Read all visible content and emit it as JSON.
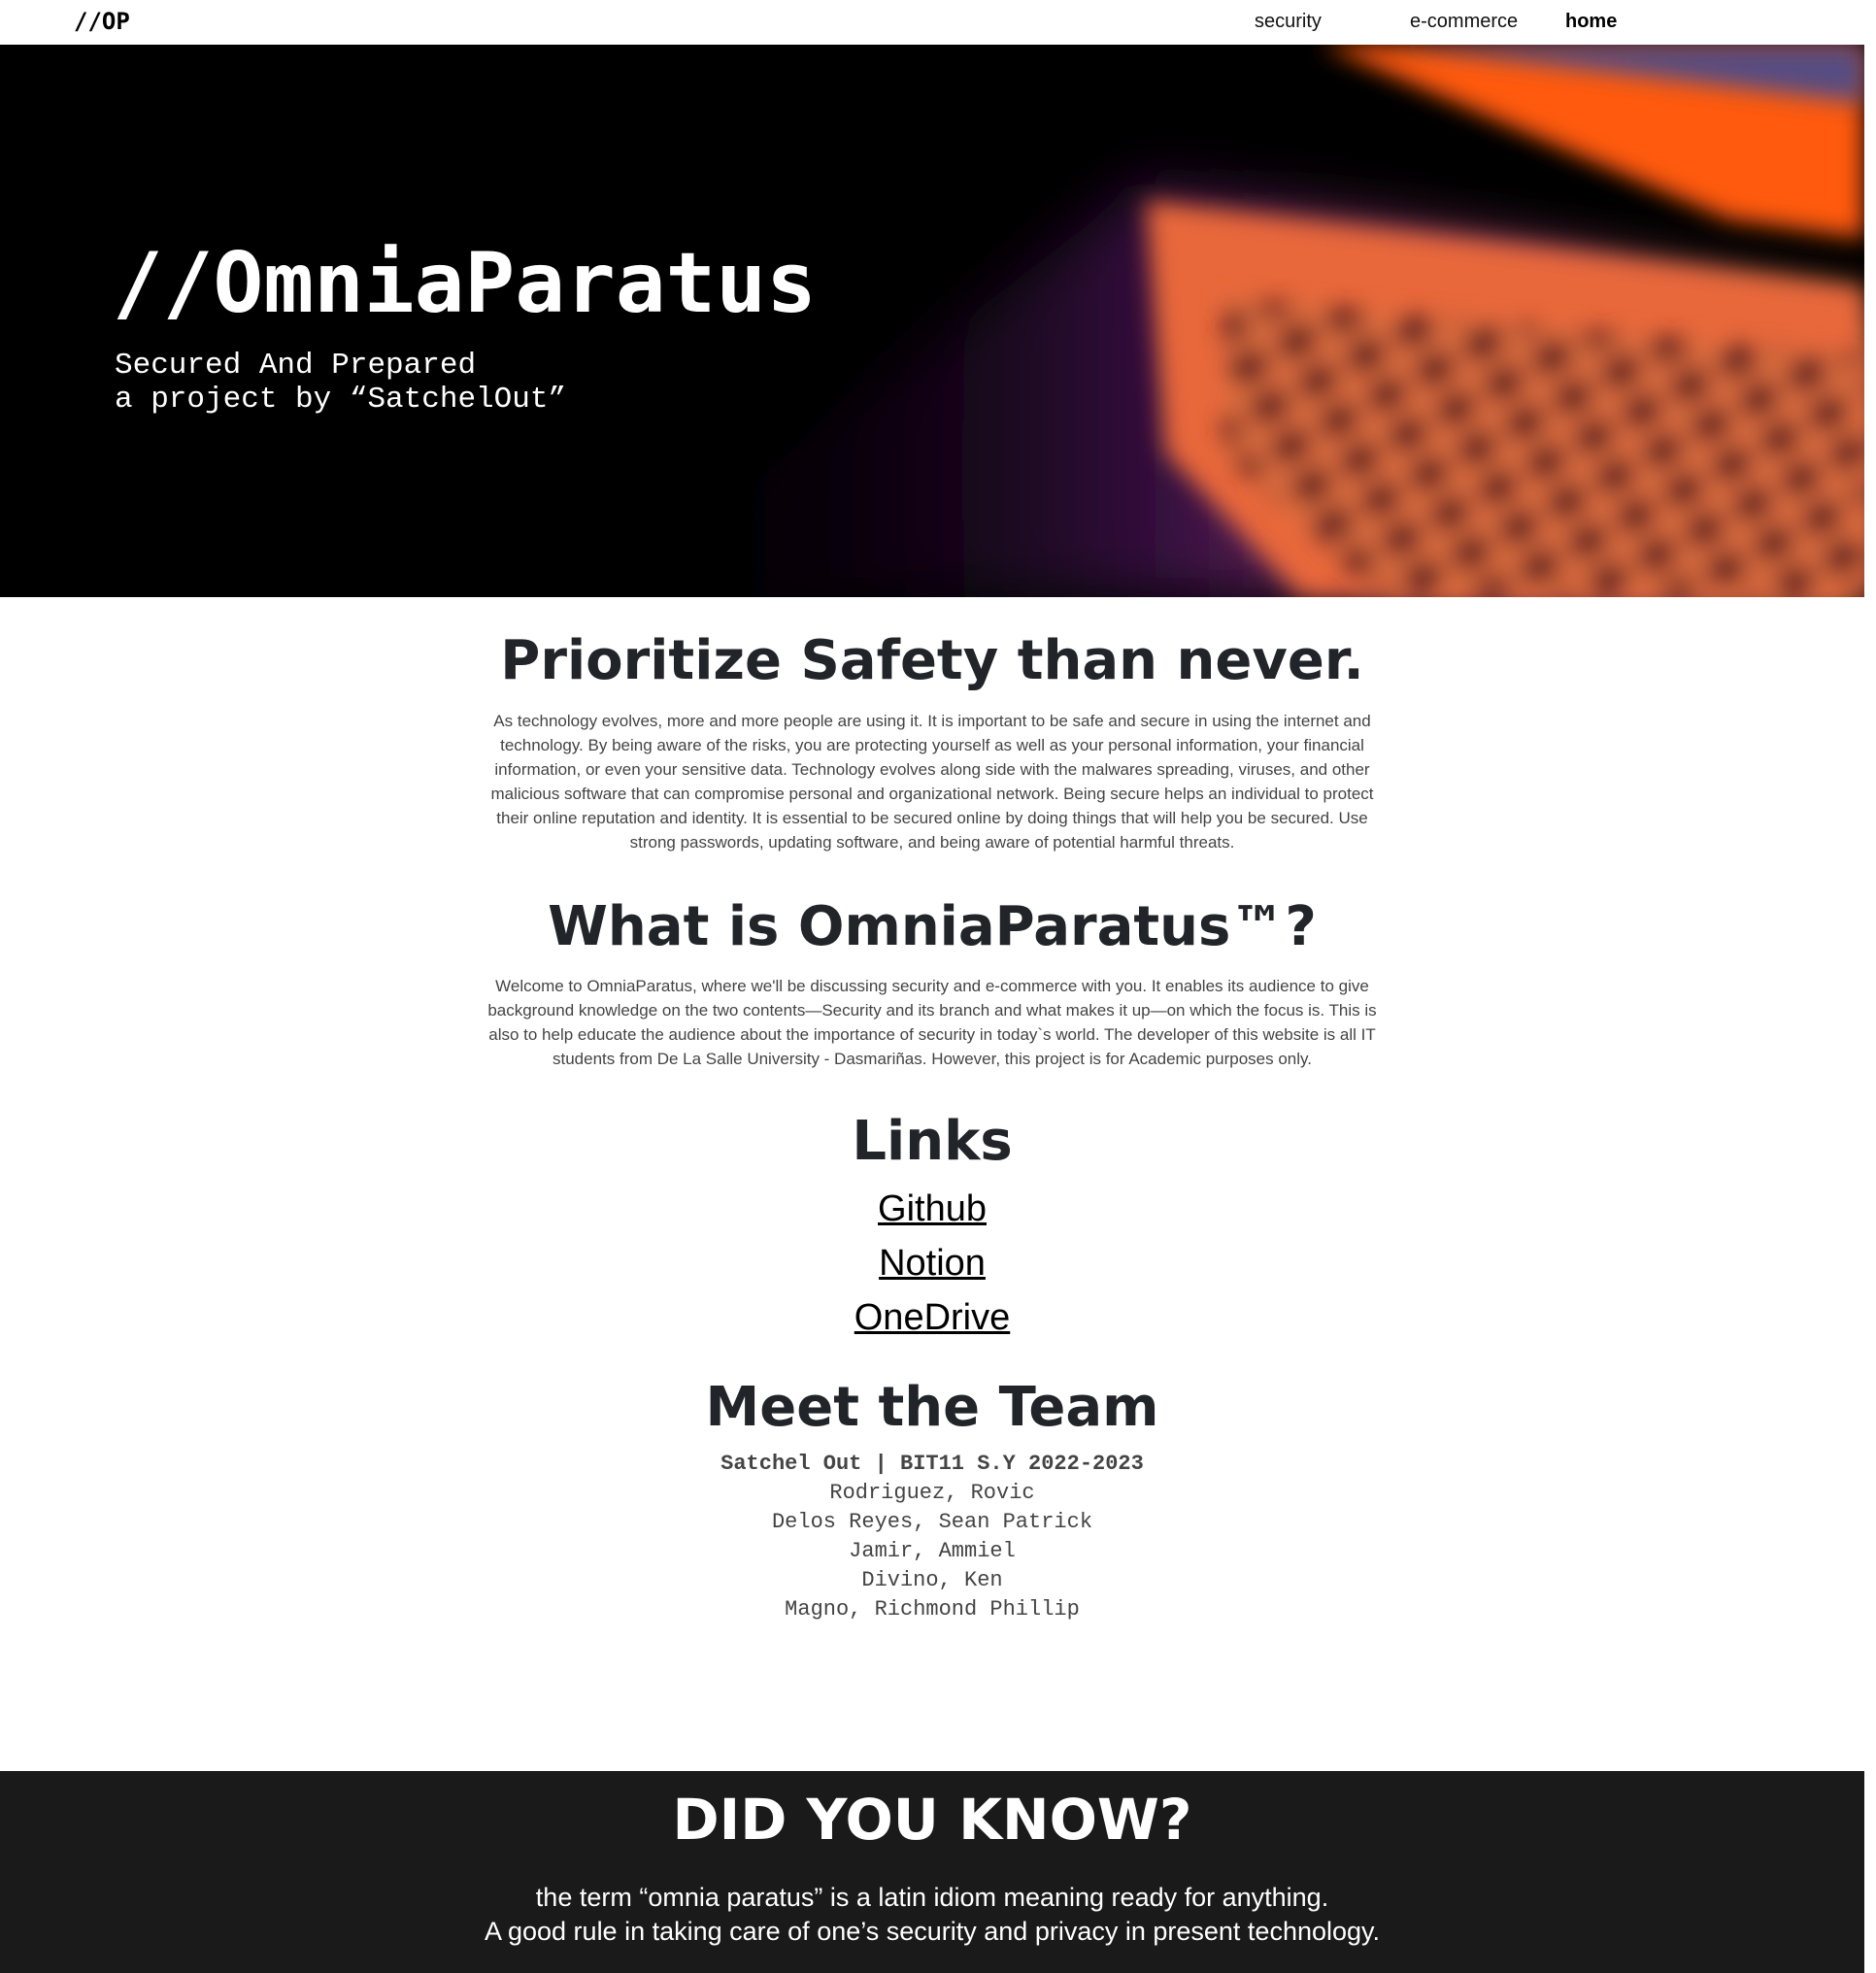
{
  "navbar": {
    "brand": "//OP",
    "links": [
      "security",
      "e-commerce",
      "home"
    ],
    "active": "home"
  },
  "hero": {
    "title": "//OmniaParatus",
    "subtitle_line1": "Secured And Prepared",
    "subtitle_line2": "a project by “SatchelOut”"
  },
  "section_safety": {
    "title": "Prioritize Safety than never.",
    "body": "As technology evolves, more and more people are using it. It is important to be safe and secure in using the internet and technology. By being aware of the risks, you are protecting yourself as well as your personal information, your financial information, or even your sensitive data. Technology evolves along side with the malwares spreading, viruses, and other malicious software that can compromise personal and organizational network. Being secure helps an individual to protect their online reputation and identity. It is essential to be secured online by doing things that will help you be secured. Use strong passwords, updating software, and being aware of potential harmful threats."
  },
  "section_about": {
    "title": "What is OmniaParatus™?",
    "body": "Welcome to OmniaParatus, where we'll be discussing security and e-commerce with you. It enables its audience to give background knowledge on the two contents—Security and its branch and what makes it up—on which the focus is. This is also to help educate the audience about the importance of security in today`s world. The developer of this website is all IT students from De La Salle University - Dasmariñas. However, this project is for Academic purposes only."
  },
  "section_links": {
    "title": "Links",
    "items": [
      "Github",
      "Notion",
      "OneDrive"
    ]
  },
  "section_team": {
    "title": "Meet the Team",
    "heading": "Satchel Out | BIT11 S.Y 2022-2023",
    "members": [
      "Rodriguez, Rovic",
      "Delos Reyes, Sean Patrick",
      "Jamir, Ammiel",
      "Divino, Ken",
      "Magno, Richmond Phillip"
    ]
  },
  "footer": {
    "title": "DID YOU KNOW?",
    "line1": "the term “omnia paratus” is a latin idiom meaning ready for anything.",
    "line2": "A good rule in taking care of one’s security and privacy in present technology."
  },
  "colors": {
    "hero_bg": "#000000",
    "footer_bg": "#1a1a1a",
    "heading": "#212529",
    "body_text": "#444444"
  }
}
